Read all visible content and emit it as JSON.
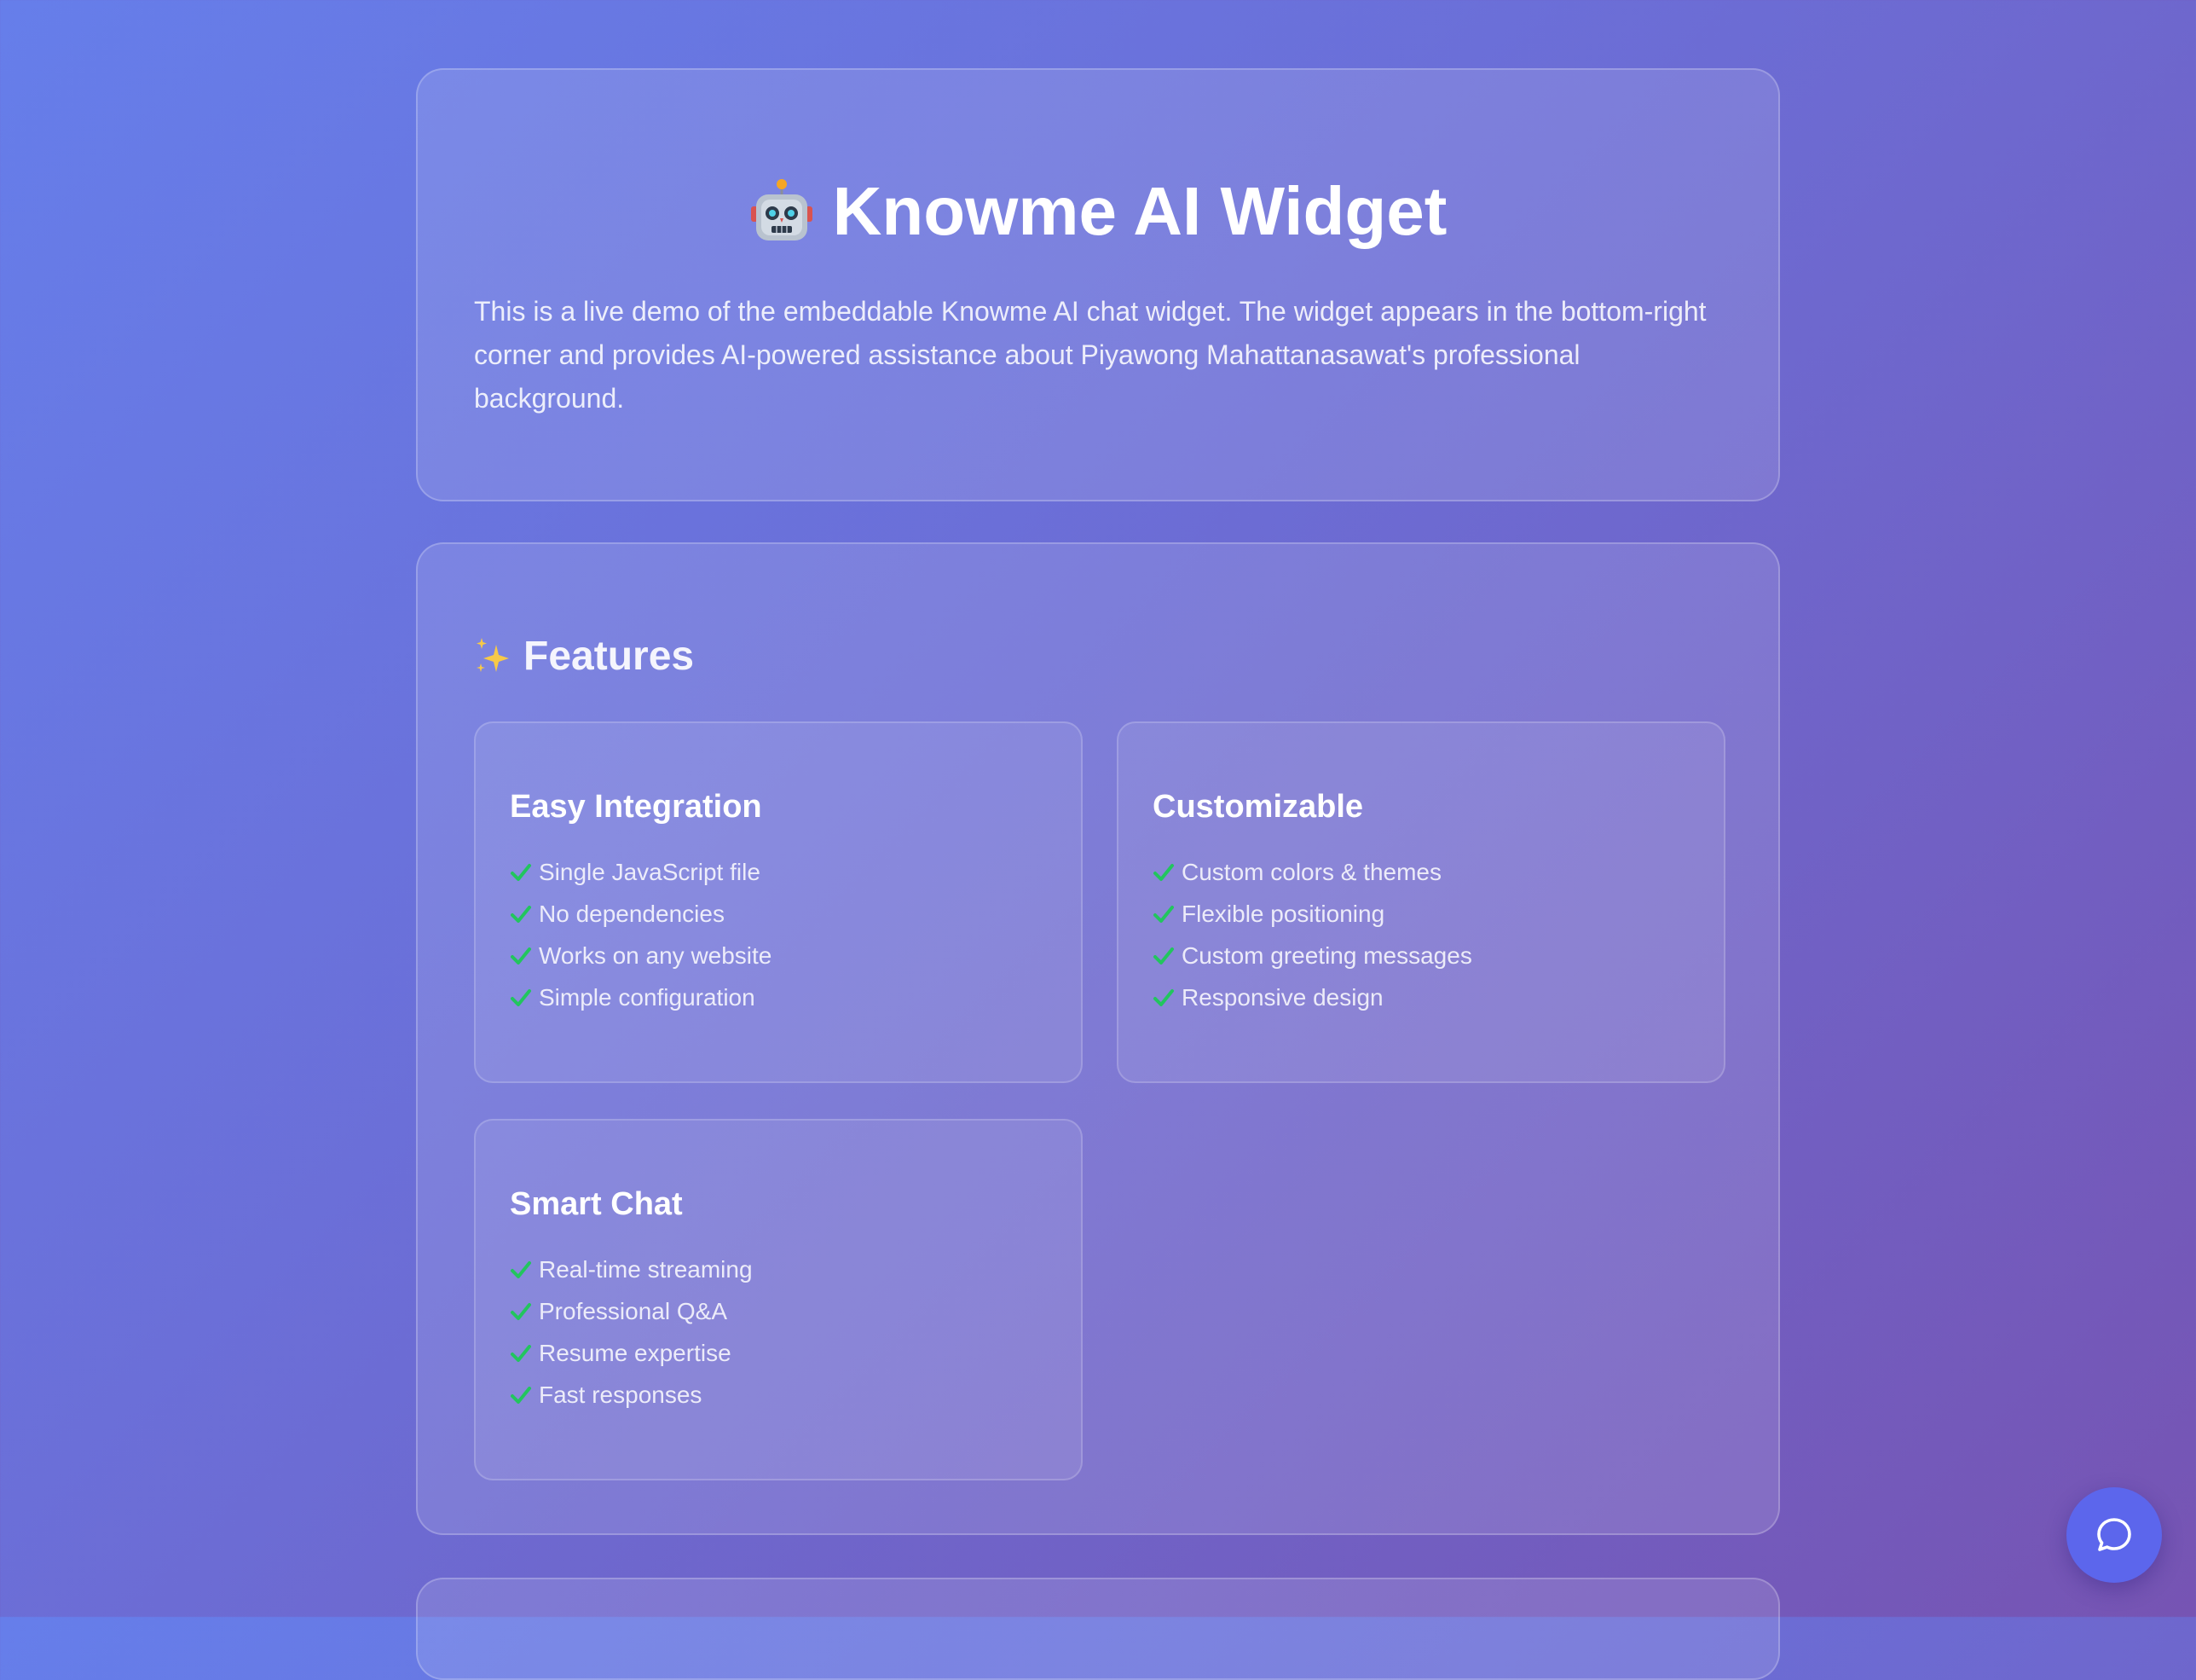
{
  "hero": {
    "icon": "robot-icon",
    "title": "Knowme AI Widget",
    "description": "This is a live demo of the embeddable Knowme AI chat widget. The widget appears in the bottom-right corner and provides AI-powered assistance about Piyawong Mahattanasawat's professional background."
  },
  "features": {
    "icon": "sparkles-icon",
    "heading": "Features",
    "check_color": "#22c55e",
    "groups": [
      {
        "title": "Easy Integration",
        "items": [
          "Single JavaScript file",
          "No dependencies",
          "Works on any website",
          "Simple configuration"
        ]
      },
      {
        "title": "Customizable",
        "items": [
          "Custom colors & themes",
          "Flexible positioning",
          "Custom greeting messages",
          "Responsive design"
        ]
      },
      {
        "title": "Smart Chat",
        "items": [
          "Real-time streaming",
          "Professional Q&A",
          "Resume expertise",
          "Fast responses"
        ]
      }
    ]
  },
  "chat_launcher": {
    "icon": "chat-bubble-icon",
    "color": "#5c66ec"
  }
}
